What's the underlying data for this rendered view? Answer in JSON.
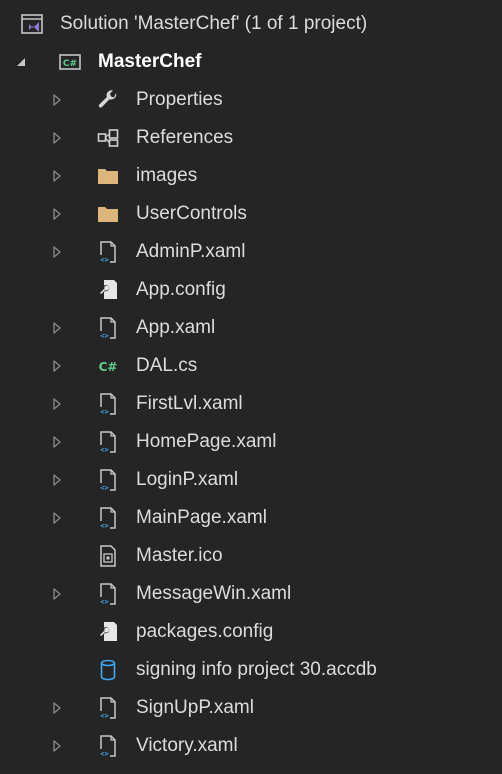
{
  "solution": {
    "label": "Solution 'MasterChef' (1 of 1 project)",
    "icon": "visual-studio-solution-icon"
  },
  "project": {
    "label": "MasterChef",
    "icon": "csharp-project-icon",
    "expanded": true
  },
  "items": [
    {
      "label": "Properties",
      "icon": "wrench-icon",
      "expandable": true
    },
    {
      "label": "References",
      "icon": "references-icon",
      "expandable": true
    },
    {
      "label": "images",
      "icon": "folder-icon",
      "expandable": true
    },
    {
      "label": "UserControls",
      "icon": "folder-icon",
      "expandable": true
    },
    {
      "label": "AdminP.xaml",
      "icon": "xaml-file-icon",
      "expandable": true
    },
    {
      "label": "App.config",
      "icon": "config-file-icon",
      "expandable": false
    },
    {
      "label": "App.xaml",
      "icon": "xaml-file-icon",
      "expandable": true
    },
    {
      "label": "DAL.cs",
      "icon": "csharp-file-icon",
      "expandable": true
    },
    {
      "label": "FirstLvl.xaml",
      "icon": "xaml-file-icon",
      "expandable": true
    },
    {
      "label": "HomePage.xaml",
      "icon": "xaml-file-icon",
      "expandable": true
    },
    {
      "label": "LoginP.xaml",
      "icon": "xaml-file-icon",
      "expandable": true
    },
    {
      "label": "MainPage.xaml",
      "icon": "xaml-file-icon",
      "expandable": true
    },
    {
      "label": "Master.ico",
      "icon": "ico-file-icon",
      "expandable": false
    },
    {
      "label": "MessageWin.xaml",
      "icon": "xaml-file-icon",
      "expandable": true
    },
    {
      "label": "packages.config",
      "icon": "config-file-icon",
      "expandable": false
    },
    {
      "label": "signing info project 30.accdb",
      "icon": "database-icon",
      "expandable": false
    },
    {
      "label": "SignUpP.xaml",
      "icon": "xaml-file-icon",
      "expandable": true
    },
    {
      "label": "Victory.xaml",
      "icon": "xaml-file-icon",
      "expandable": true
    }
  ],
  "colors": {
    "background": "#252526",
    "text": "#dcdcdc",
    "arrow": "#8a8a8a",
    "folder": "#dcb67a",
    "csharp": "#5fce8b",
    "solution": "#8f7ad6"
  }
}
